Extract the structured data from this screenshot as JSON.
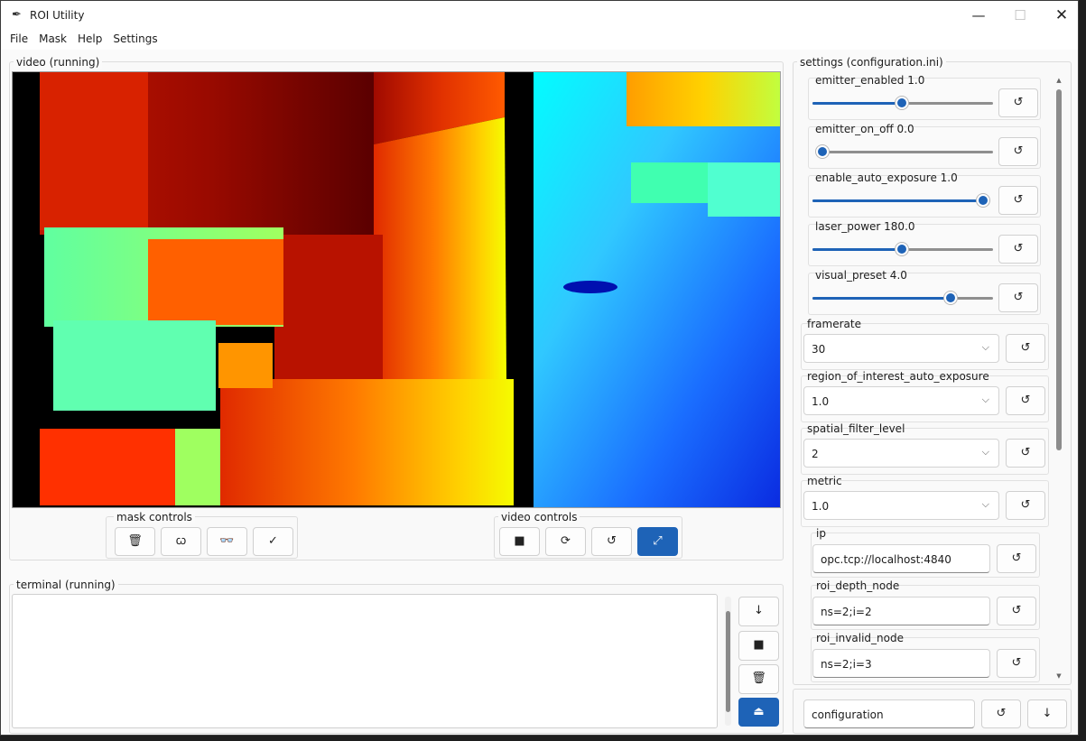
{
  "window": {
    "title": "ROI Utility",
    "app_icon": "feather-icon",
    "controls": {
      "minimize": "—",
      "maximize": "☐",
      "close": "✕"
    }
  },
  "menu": [
    "File",
    "Mask",
    "Help",
    "Settings"
  ],
  "video_panel": {
    "label": "video (running)",
    "mask_controls": {
      "label": "mask controls",
      "buttons": [
        {
          "name": "delete-mask",
          "icon": "🗑"
        },
        {
          "name": "draw-mask",
          "icon": "ꞷ"
        },
        {
          "name": "view-mask",
          "icon": "👓"
        },
        {
          "name": "apply-mask",
          "icon": "✓"
        }
      ]
    },
    "video_controls": {
      "label": "video controls",
      "buttons": [
        {
          "name": "stop-video",
          "icon": "■"
        },
        {
          "name": "restart-video",
          "icon": "⟳"
        },
        {
          "name": "reset-video",
          "icon": "↺"
        },
        {
          "name": "fullscreen-video",
          "icon": "⤢"
        }
      ]
    }
  },
  "terminal": {
    "label": "terminal (running)",
    "content": "",
    "buttons": [
      {
        "name": "scroll-down",
        "icon": "↓"
      },
      {
        "name": "stop-terminal",
        "icon": "■"
      },
      {
        "name": "clear-terminal",
        "icon": "🗑"
      },
      {
        "name": "open-terminal",
        "icon": "⏏"
      }
    ]
  },
  "settings": {
    "label": "settings (configuration.ini)",
    "reset_icon": "↺",
    "sliders": [
      {
        "label": "emitter_enabled 1.0",
        "value": 0.5
      },
      {
        "label": "emitter_on_off 0.0",
        "value": 0.0
      },
      {
        "label": "enable_auto_exposure 1.0",
        "value": 1.0
      },
      {
        "label": "laser_power 180.0",
        "value": 0.5
      },
      {
        "label": "visual_preset 4.0",
        "value": 0.8
      }
    ],
    "combos": [
      {
        "label": "framerate",
        "value": "30"
      },
      {
        "label": "region_of_interest_auto_exposure",
        "value": "1.0"
      },
      {
        "label": "spatial_filter_level",
        "value": "2"
      },
      {
        "label": "metric",
        "value": "1.0"
      }
    ],
    "entries": [
      {
        "label": "ip",
        "value": "opc.tcp://localhost:4840"
      },
      {
        "label": "roi_depth_node",
        "value": "ns=2;i=2"
      },
      {
        "label": "roi_invalid_node",
        "value": "ns=2;i=3"
      }
    ],
    "footer": {
      "config_name": "configuration",
      "reload_icon": "↺",
      "save_icon": "↓"
    }
  },
  "colors": {
    "accent": "#1e63b7"
  }
}
